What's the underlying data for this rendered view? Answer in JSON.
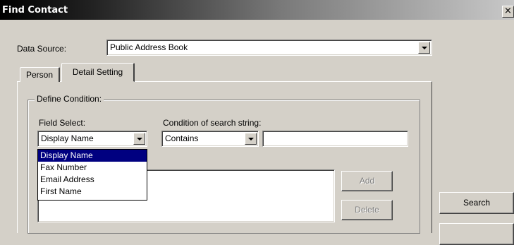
{
  "window": {
    "title": "Find Contact",
    "close_glyph": "×"
  },
  "data_source": {
    "label": "Data Source:",
    "value": "Public Address Book"
  },
  "tabs": [
    {
      "label": "Person",
      "active": false
    },
    {
      "label": "Detail Setting",
      "active": true
    }
  ],
  "define_condition": {
    "title": "Define Condition:",
    "field_select_label": "Field Select:",
    "field_select_value": "Display Name",
    "condition_label": "Condition of search string:",
    "condition_value": "Contains",
    "search_string_value": ""
  },
  "field_options": [
    "Display Name",
    "Fax Number",
    "Email Address",
    "First Name"
  ],
  "buttons": {
    "add": "Add",
    "delete": "Delete",
    "search": "Search"
  },
  "colors": {
    "selection": "#000080",
    "face": "#d4d0c8"
  }
}
